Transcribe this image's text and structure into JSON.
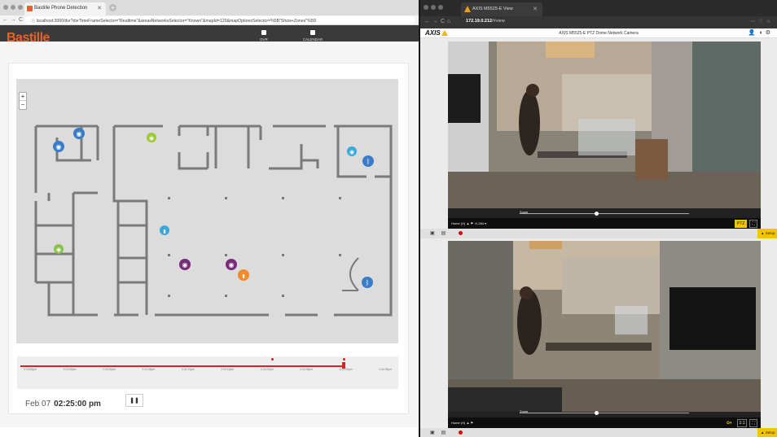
{
  "left": {
    "tab_title": "Bastille Phone Detection",
    "url": "localhost:3000/dvr?dvrTimeFrameSelector=\"Realtime\"&areasNetworksSelector=\"Known\"&mapId=120&mapOptionsSelector=%5B\"Show+Zones\"%5D",
    "logo": "Bastille",
    "nav": [
      {
        "label": "DVR",
        "active": true
      },
      {
        "label": "CALENDAR",
        "active": false
      }
    ],
    "zoom_in": "+",
    "zoom_out": "−",
    "timeline_ticks": [
      "2:23:50pm",
      "2:23:55pm",
      "2:24:00pm",
      "2:24:05pm",
      "2:24:10pm",
      "2:24:15pm",
      "2:24:20pm",
      "2:24:25pm",
      "2:24:30pm",
      "2:24:35pm",
      "2:24:40pm",
      "2:24:45pm",
      "2:24:50pm",
      "2:24:55pm",
      "2:25:00pm",
      "2:25:05pm"
    ],
    "timeline_label_ticks": [
      "2:23:50pm",
      "2:23:55pm",
      "2:24:00pm",
      "2:24:05pm",
      "2:24:10pm",
      "2:24:15pm",
      "2:24:20pm",
      "2:24:25pm",
      "2:24:30pm",
      "2:24:35pm"
    ],
    "date_label": "Feb 07",
    "time_label": "02:25:00 pm",
    "pause_label": "❚❚",
    "marker_colors": {
      "blue": "#3a7cc8",
      "green": "#9bcc2e",
      "teal": "#3aa8d8",
      "purple": "#7a2a7a",
      "orange": "#f08a2a",
      "lime": "#8bc34a"
    }
  },
  "right": {
    "tab_title": "AXIS M5525-E View",
    "url_host": "172.19.0.212",
    "url_path": "/#view",
    "camera_title": "AXIS M5525-E PTZ Dome Network Camera",
    "logo": "AXIS",
    "cam1": {
      "home": "Home (H)",
      "codec": "H.264",
      "zoom": "Zoom",
      "ptz": "PTZ"
    },
    "cam2": {
      "home": "Home (H)",
      "zoom": "Zoom",
      "ratio": "1:1"
    },
    "setup_label": "Setup"
  }
}
